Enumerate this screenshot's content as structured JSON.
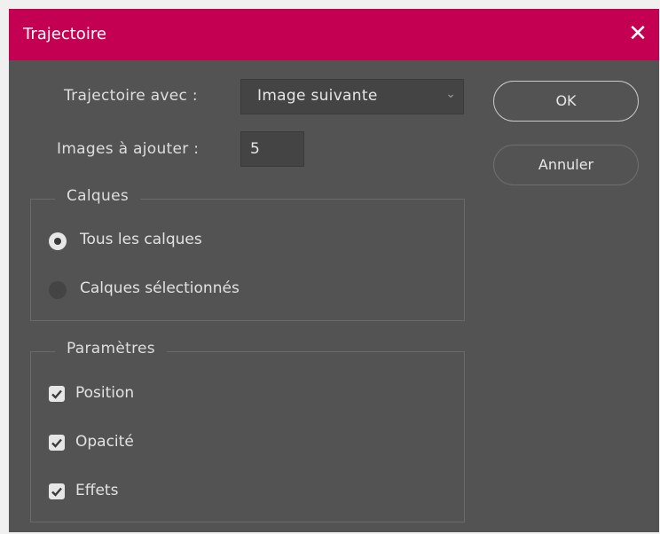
{
  "dialog": {
    "title": "Trajectoire",
    "close_icon": "close-icon"
  },
  "form": {
    "trajectory_label": "Trajectoire avec :",
    "trajectory_value": "Image suivante",
    "frames_label": "Images à ajouter :",
    "frames_value": "5"
  },
  "buttons": {
    "ok_label": "OK",
    "cancel_label": "Annuler"
  },
  "layers_group": {
    "legend": "Calques",
    "options": [
      {
        "label": "Tous les calques",
        "selected": true
      },
      {
        "label": "Calques sélectionnés",
        "selected": false
      }
    ]
  },
  "params_group": {
    "legend": "Paramètres",
    "options": [
      {
        "label": "Position",
        "checked": true
      },
      {
        "label": "Opacité",
        "checked": true
      },
      {
        "label": "Effets",
        "checked": true
      }
    ]
  },
  "colors": {
    "titlebar": "#c40052",
    "panel": "#535353",
    "field": "#444444"
  }
}
